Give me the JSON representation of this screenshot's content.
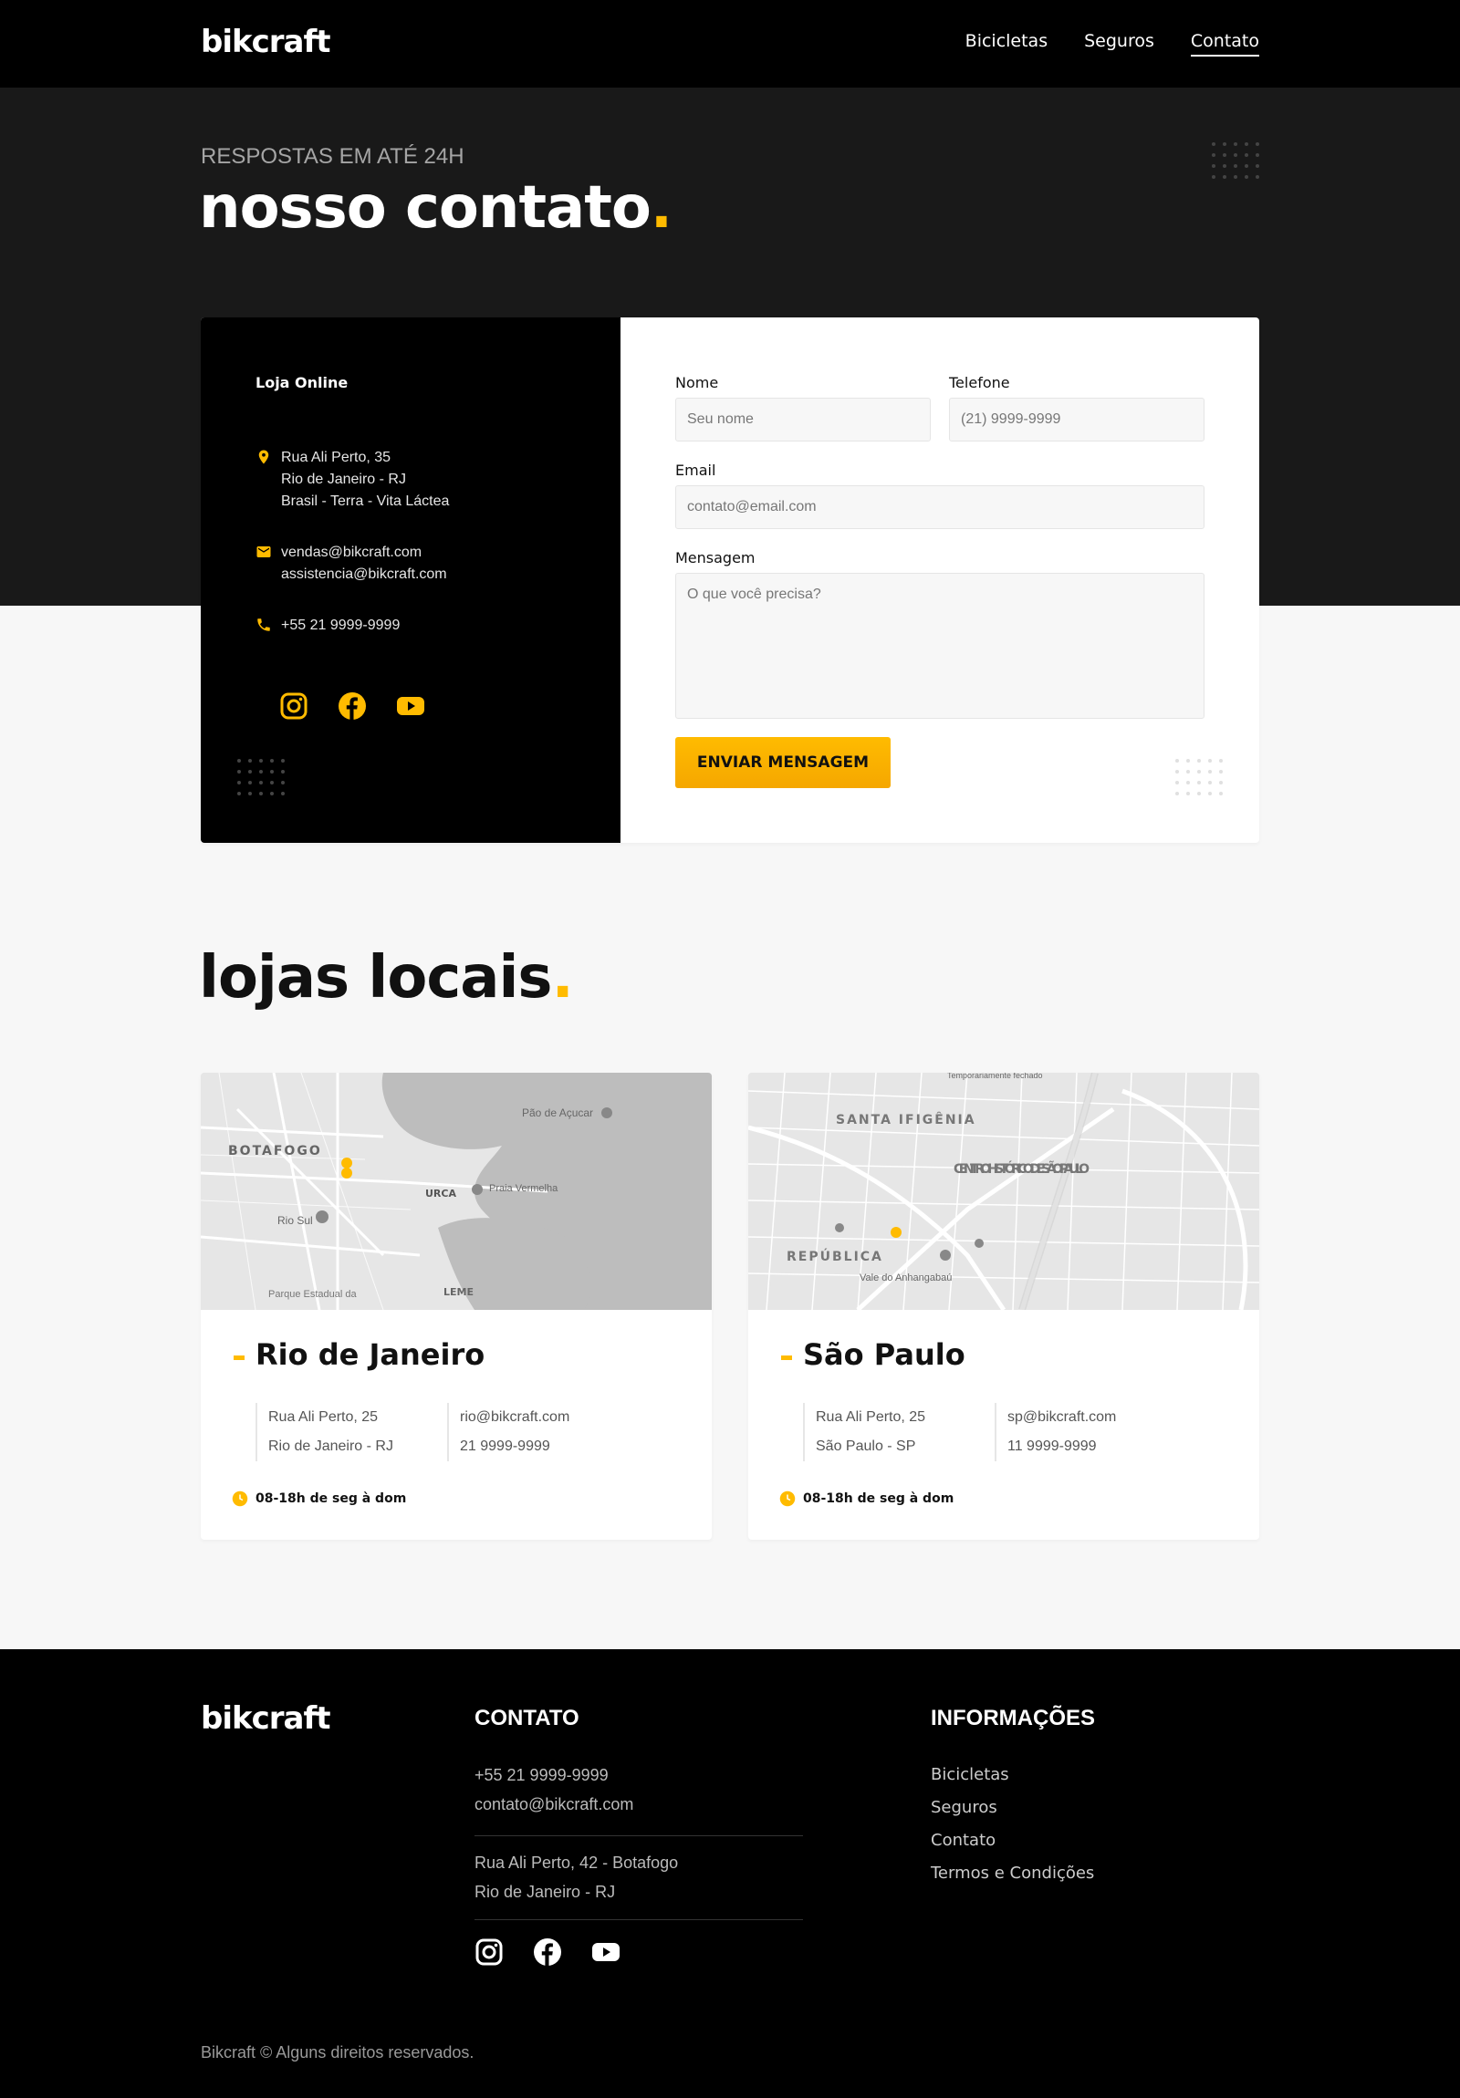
{
  "header": {
    "logo": "bikcraft",
    "nav": [
      {
        "label": "Bicicletas"
      },
      {
        "label": "Seguros"
      },
      {
        "label": "Contato",
        "active": true
      }
    ]
  },
  "hero": {
    "subtitle": "RESPOSTAS EM ATÉ 24H",
    "title": "nosso contato",
    "title_dot": "."
  },
  "contact_info": {
    "title": "Loja Online",
    "address": [
      "Rua Ali Perto, 35",
      "Rio de Janeiro - RJ",
      "Brasil - Terra - Vita Láctea"
    ],
    "emails": [
      "vendas@bikcraft.com",
      "assistencia@bikcraft.com"
    ],
    "phone": "+55 21 9999-9999",
    "socials": [
      "instagram-icon",
      "facebook-icon",
      "youtube-icon"
    ]
  },
  "form": {
    "name_label": "Nome",
    "name_placeholder": "Seu nome",
    "phone_label": "Telefone",
    "phone_placeholder": "(21) 9999-9999",
    "email_label": "Email",
    "email_placeholder": "contato@email.com",
    "message_label": "Mensagem",
    "message_placeholder": "O que você precisa?",
    "submit_label": "ENVIAR MENSAGEM"
  },
  "lojas": {
    "title": "lojas locais",
    "title_dot": ".",
    "stores": [
      {
        "name": "Rio de Janeiro",
        "address": [
          "Rua Ali Perto, 25",
          "Rio de Janeiro - RJ"
        ],
        "contact": [
          "rio@bikcraft.com",
          "21 9999-9999"
        ],
        "hours": "08-18h de seg à dom",
        "map_labels": [
          "BOTAFOGO",
          "Pão de Açucar",
          "URCA",
          "Praia Vermelha",
          "Rio Sul",
          "LEME",
          "Parque Estadual da"
        ]
      },
      {
        "name": "São Paulo",
        "address": [
          "Rua Ali Perto, 25",
          "São Paulo - SP"
        ],
        "contact": [
          "sp@bikcraft.com",
          "11 9999-9999"
        ],
        "hours": "08-18h de seg à dom",
        "map_labels": [
          "SANTA IFIGÊNIA",
          "CENTRO HISTÓRICO DE SÃO PAULO",
          "REPÚBLICA",
          "Vale do Anhangabaú",
          "Temporariamente fechado"
        ]
      }
    ]
  },
  "footer": {
    "logo": "bikcraft",
    "contact_title": "CONTATO",
    "contact_phone": "+55 21 9999-9999",
    "contact_email": "contato@bikcraft.com",
    "contact_address": [
      "Rua Ali Perto, 42 - Botafogo",
      "Rio de Janeiro - RJ"
    ],
    "info_title": "INFORMAÇÕES",
    "links": [
      "Bicicletas",
      "Seguros",
      "Contato",
      "Termos e Condições"
    ],
    "copyright": "Bikcraft © Alguns direitos reservados."
  },
  "colors": {
    "accent": "#ffbb00",
    "dark": "#000000",
    "hero_bg": "#191919",
    "page_bg": "#f7f7f7"
  }
}
